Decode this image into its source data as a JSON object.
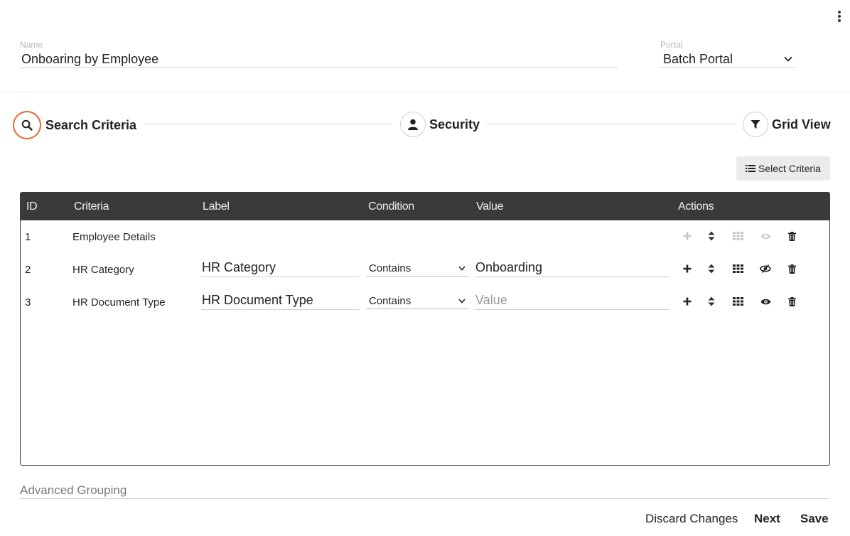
{
  "header": {
    "name_caption": "Name",
    "name_value": "Onboaring by Employee",
    "portal_caption": "Portal",
    "portal_value": "Batch Portal"
  },
  "steps": [
    {
      "label": "Search Criteria",
      "icon": "search-icon",
      "active": true
    },
    {
      "label": "Security",
      "icon": "user-icon",
      "active": false
    },
    {
      "label": "Grid View",
      "icon": "filter-icon",
      "active": false
    }
  ],
  "select_criteria_label": "Select Criteria",
  "grid": {
    "columns": [
      "ID",
      "Criteria",
      "Label",
      "Condition",
      "Value",
      "Actions"
    ],
    "rows": [
      {
        "id": "1",
        "criteria": "Employee Details",
        "label": "",
        "condition": "",
        "value": "",
        "value_placeholder": "",
        "disabled_actions": true,
        "visible": true
      },
      {
        "id": "2",
        "criteria": "HR Category",
        "label": "HR Category",
        "condition": "Contains",
        "value": "Onboarding",
        "value_placeholder": "Value",
        "disabled_actions": false,
        "visible": false
      },
      {
        "id": "3",
        "criteria": "HR Document Type",
        "label": "HR Document Type",
        "condition": "Contains",
        "value": "",
        "value_placeholder": "Value",
        "disabled_actions": false,
        "visible": true
      }
    ]
  },
  "advanced_grouping_label": "Advanced Grouping",
  "footer": {
    "discard_label": "Discard Changes",
    "next_label": "Next",
    "save_label": "Save"
  },
  "colors": {
    "accent": "#e66a2c",
    "header_bg": "#3a3a3a"
  }
}
